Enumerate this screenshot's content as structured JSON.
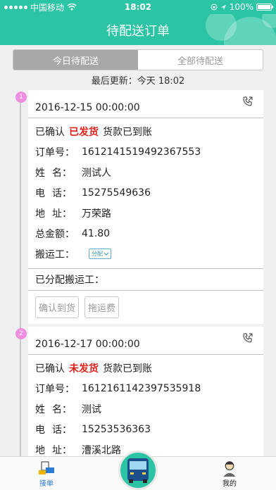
{
  "status_bar": {
    "carrier": "中国移动",
    "time": "18:02",
    "battery": "100%",
    "battery_level": 1.0
  },
  "header": {
    "title": "待配送订单"
  },
  "tabs": [
    {
      "label": "今日待配送",
      "active": true
    },
    {
      "label": "全部待配送",
      "active": false
    }
  ],
  "last_update": "最后更新：今天 18:02",
  "orders": [
    {
      "index": "1",
      "datetime": "2016-12-15 00:00:00",
      "status_prefix": "已确认",
      "ship_status": "已发货",
      "pay_status": "货款已到账",
      "order_label": "订单号：",
      "order_no": "1612141519492367553",
      "name_label_a": "姓",
      "name_label_b": "名：",
      "name": "测试人",
      "phone_label_a": "电",
      "phone_label_b": "话：",
      "phone": "15275549636",
      "addr_label_a": "地",
      "addr_label_b": "址：",
      "address": "万荣路",
      "total_label": "总金额：",
      "total": "41.80",
      "porter_label": "搬运工：",
      "assign_label": "分配",
      "assigned_label": "已分配搬运工：",
      "confirm_button": "确认到货",
      "fee_button": "拖运费"
    },
    {
      "index": "2",
      "datetime": "2016-12-17 00:00:00",
      "status_prefix": "已确认",
      "ship_status": "未发货",
      "pay_status": "货款已到账",
      "order_label": "订单号：",
      "order_no": "1612161142397535918",
      "name_label_a": "姓",
      "name_label_b": "名：",
      "name": "测试",
      "phone_label_a": "电",
      "phone_label_b": "话：",
      "phone": "15253536363",
      "addr_label_a": "地",
      "addr_label_b": "址：",
      "address": "漕溪北路"
    }
  ],
  "bottom_nav": [
    {
      "label": "接单",
      "icon": "order-icon",
      "active": true
    },
    {
      "label": "",
      "icon": "bus-icon",
      "active": false
    },
    {
      "label": "我的",
      "icon": "profile-icon",
      "active": false
    }
  ],
  "colors": {
    "accent": "#2bc4a4",
    "alert": "#e0201a",
    "timeline_badge": "#f08fe0"
  }
}
